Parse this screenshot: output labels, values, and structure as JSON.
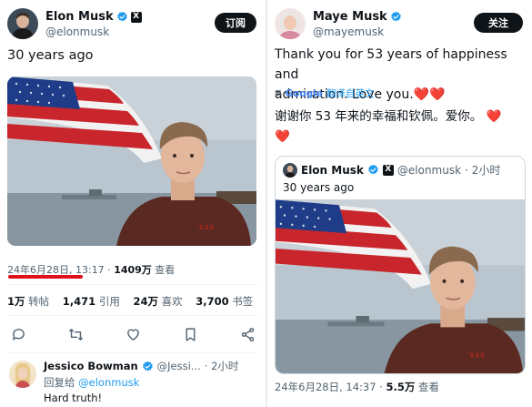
{
  "left": {
    "author": {
      "name": "Elon Musk",
      "handle": "@elonmusk"
    },
    "follow_label": "订阅",
    "text": "30 years ago",
    "timestamp": "24年6月28日, 13:17 · ",
    "views_count": "1409万",
    "views_label": " 查看",
    "stats": [
      {
        "value": "1万",
        "label": " 转帖"
      },
      {
        "value": "1,471",
        "label": " 引用"
      },
      {
        "value": "24万",
        "label": " 喜欢"
      },
      {
        "value": "3,700",
        "label": " 书签"
      }
    ],
    "reply": {
      "name": "Jessico Bowman",
      "handle": "@Jessi...",
      "time": "· 2小时",
      "replying_prefix": "回复给 ",
      "replying_to": "@elonmusk",
      "text": "Hard truth!"
    }
  },
  "right": {
    "author": {
      "name": "Maye Musk",
      "handle": "@mayemusk"
    },
    "follow_label": "关注",
    "text_line1": "Thank you for 53 years of happiness and",
    "text_line2": "admiration. Love you.",
    "hearts": "❤️❤️",
    "google_label": "Google",
    "translate_label": "翻译自英文",
    "translated_line1": "谢谢你 53 年来的幸福和钦佩。爱你。",
    "translated_heart1": "❤️",
    "translated_heart2": "❤️",
    "quote": {
      "name": "Elon Musk",
      "handle": "@elonmusk",
      "time": "· 2小时",
      "text": "30 years ago"
    },
    "timestamp": "24年6月28日, 14:37 · ",
    "views_count": "5.5万",
    "views_label": " 查看"
  },
  "colors": {
    "accent": "#1d9bf0",
    "underline": "#e0101a",
    "heart": "#e0245e"
  }
}
